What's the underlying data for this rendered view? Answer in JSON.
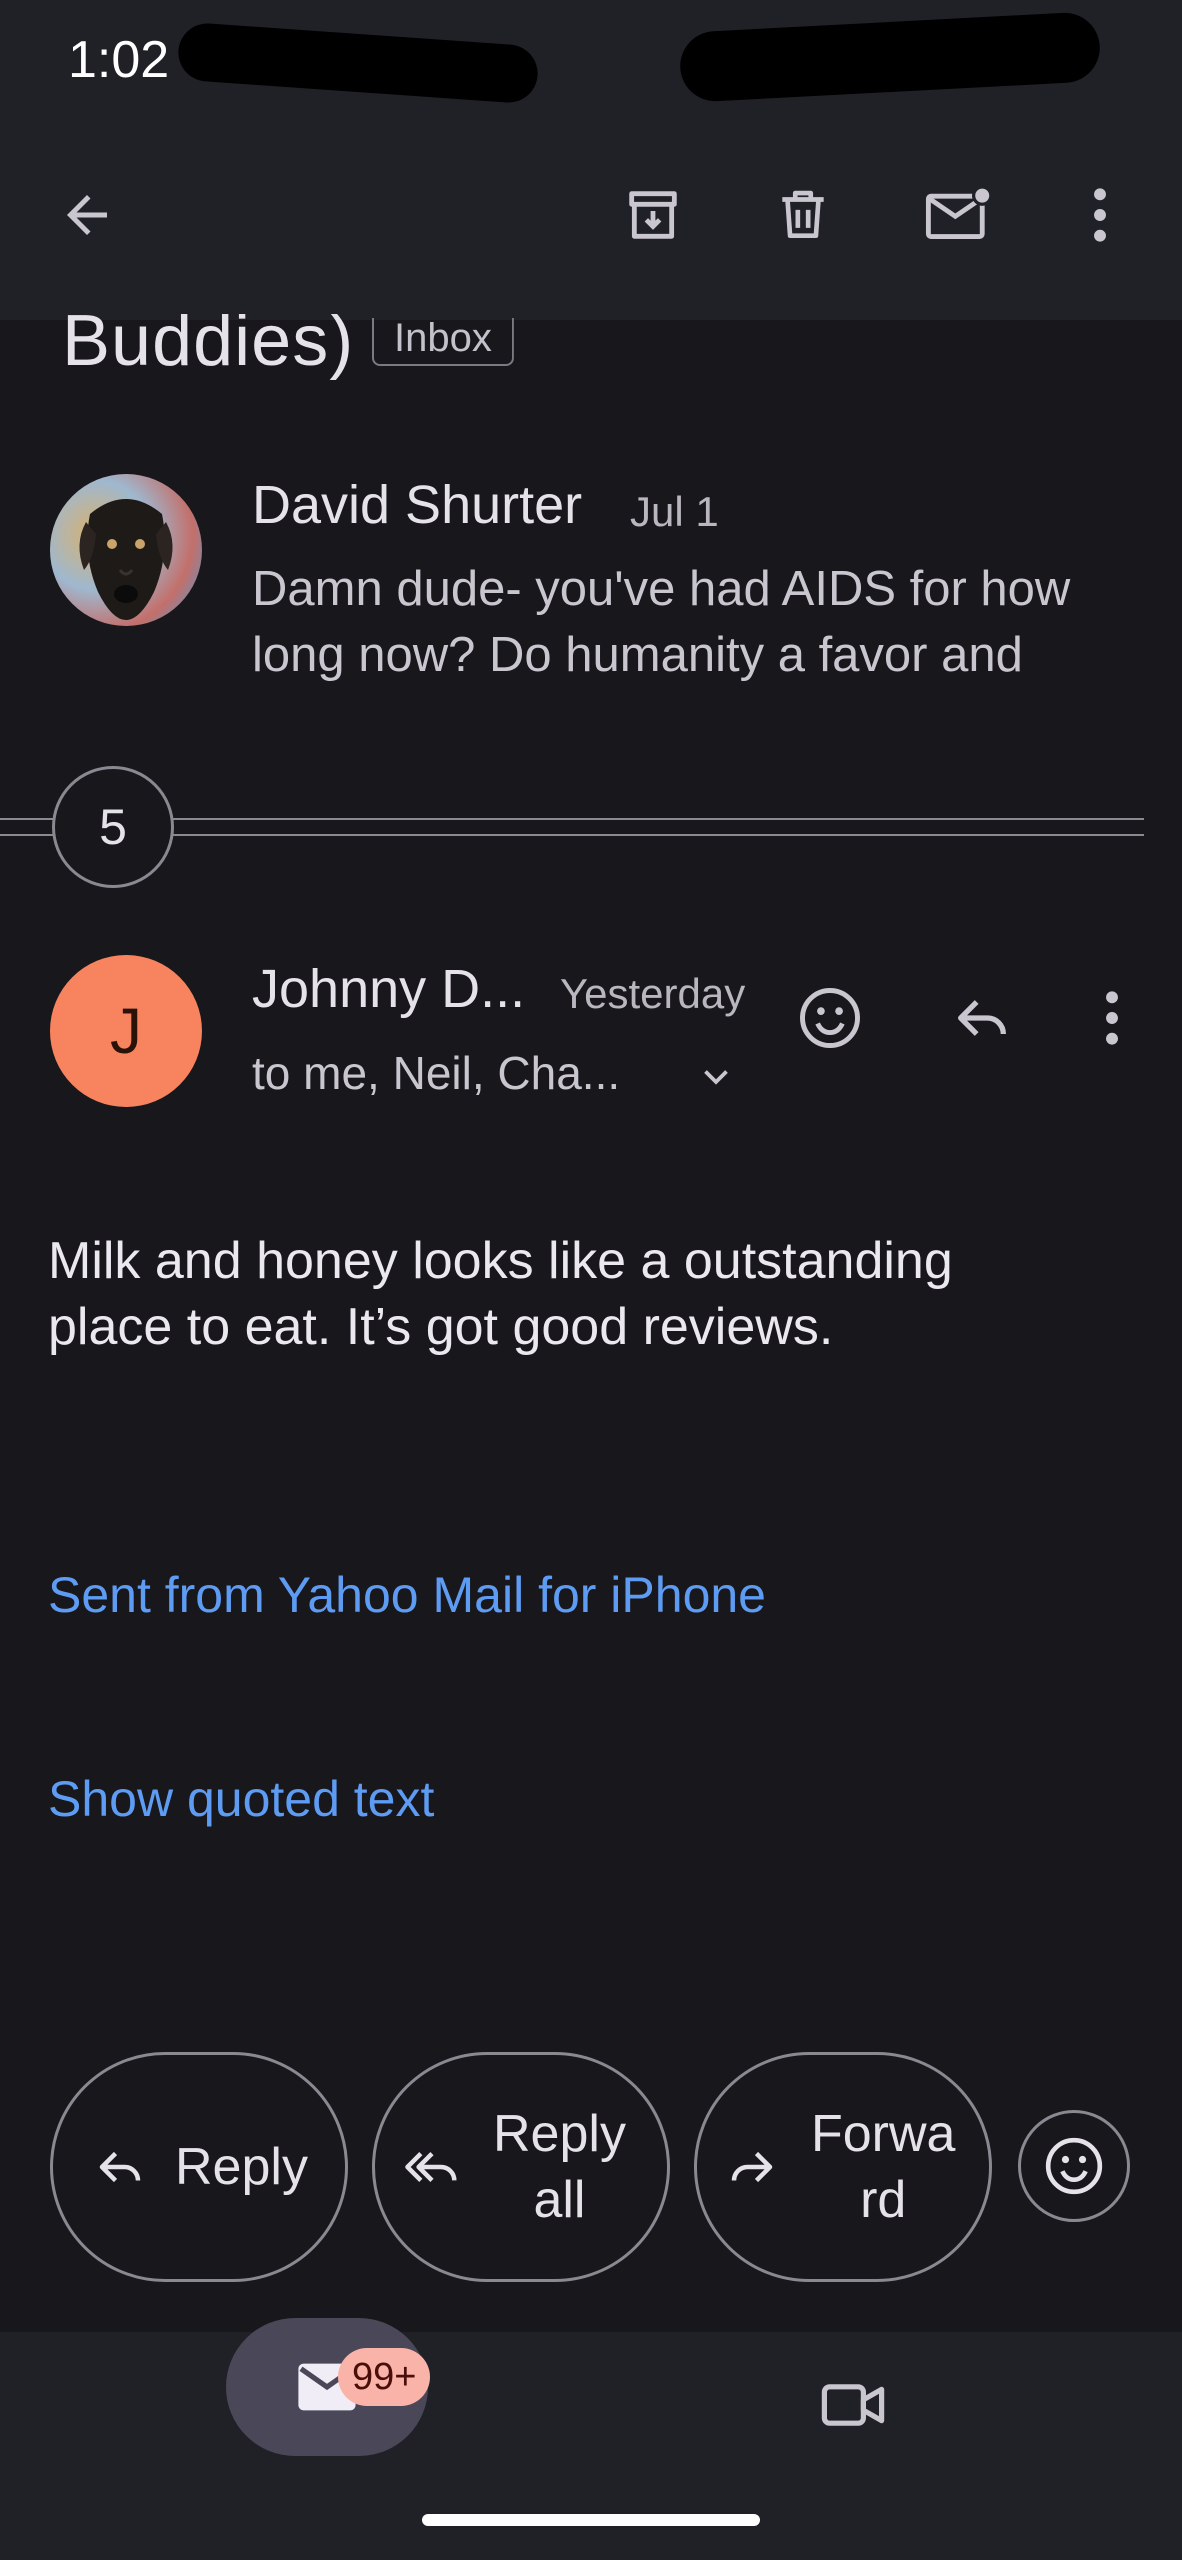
{
  "status_bar": {
    "time": "1:02"
  },
  "toolbar": {
    "actions": [
      "archive-icon",
      "delete-icon",
      "mark-unread-icon",
      "more-vert-icon"
    ]
  },
  "thread": {
    "subject_fragment": "Buddies)",
    "label_chip": "Inbox"
  },
  "collapsed_message": {
    "sender": "David Shurter",
    "date": "Jul 1",
    "snippet_line1": "Damn dude- you've had AIDS for how",
    "snippet_line2": "long now? Do humanity a favor and"
  },
  "collapsed_count": "5",
  "expanded_message": {
    "avatar_letter": "J",
    "avatar_color": "#f7845e",
    "sender": "Johnny D...",
    "date": "Yesterday",
    "recipients": "to me, Neil, Cha...",
    "body_line1": "Milk and honey looks like a outstanding",
    "body_line2": "place to eat. It’s got good reviews.",
    "signature_link": "Sent from Yahoo Mail for iPhone",
    "show_quoted": "Show quoted text"
  },
  "actions": {
    "reply": "Reply",
    "reply_all_line1": "Reply",
    "reply_all_line2": "all",
    "forward_line1": "Forwa",
    "forward_line2": "rd"
  },
  "bottom_nav": {
    "mail_badge": "99+"
  },
  "colors": {
    "background": "#17171c",
    "surface": "#202127",
    "link": "#5e9bf2",
    "badge": "#f9b3a8"
  }
}
